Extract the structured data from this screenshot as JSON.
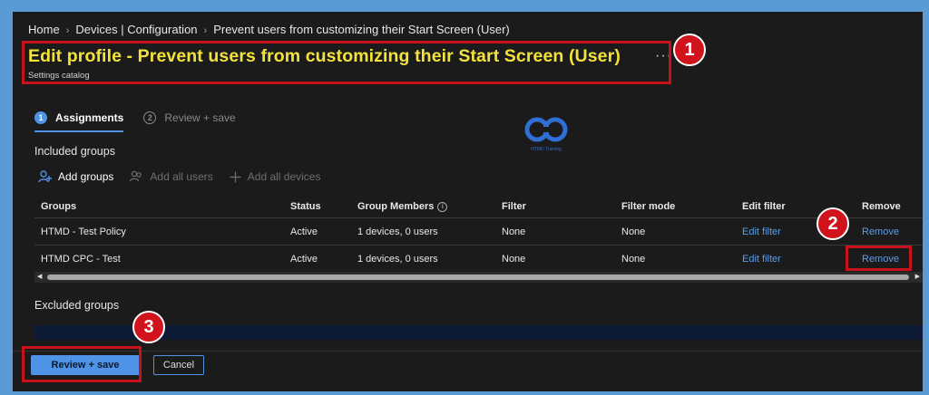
{
  "breadcrumb": [
    "Home",
    "Devices | Configuration",
    "Prevent users from customizing their Start Screen (User)"
  ],
  "header": {
    "title": "Edit profile - Prevent users from customizing their Start Screen (User)",
    "subtitle": "Settings catalog",
    "more": "···"
  },
  "steps": [
    {
      "num": "1",
      "label": "Assignments",
      "active": true
    },
    {
      "num": "2",
      "label": "Review + save",
      "active": false
    }
  ],
  "logo": {
    "text": "HTMD Training"
  },
  "included_label": "Included groups",
  "excluded_label": "Excluded groups",
  "actions": [
    {
      "label": "Add groups",
      "icon": "add-group-icon",
      "enabled": true
    },
    {
      "label": "Add all users",
      "icon": "users-icon",
      "enabled": false
    },
    {
      "label": "Add all devices",
      "icon": "plus-icon",
      "enabled": false
    }
  ],
  "table": {
    "columns": [
      "Groups",
      "Status",
      "Group Members",
      "Filter",
      "Filter mode",
      "Edit filter",
      "Remove"
    ],
    "rows": [
      {
        "group": "HTMD - Test Policy",
        "status": "Active",
        "members": "1 devices, 0 users",
        "filter": "None",
        "filter_mode": "None",
        "edit_filter": "Edit filter",
        "remove": "Remove"
      },
      {
        "group": "HTMD CPC - Test",
        "status": "Active",
        "members": "1 devices, 0 users",
        "filter": "None",
        "filter_mode": "None",
        "edit_filter": "Edit filter",
        "remove": "Remove"
      }
    ]
  },
  "buttons": {
    "review_save": "Review + save",
    "cancel": "Cancel"
  },
  "markers": [
    "1",
    "2",
    "3"
  ],
  "colors": {
    "accent": "#4f93e6",
    "title": "#f3e23a",
    "annotation": "#c8121b",
    "link": "#5a9de6"
  }
}
